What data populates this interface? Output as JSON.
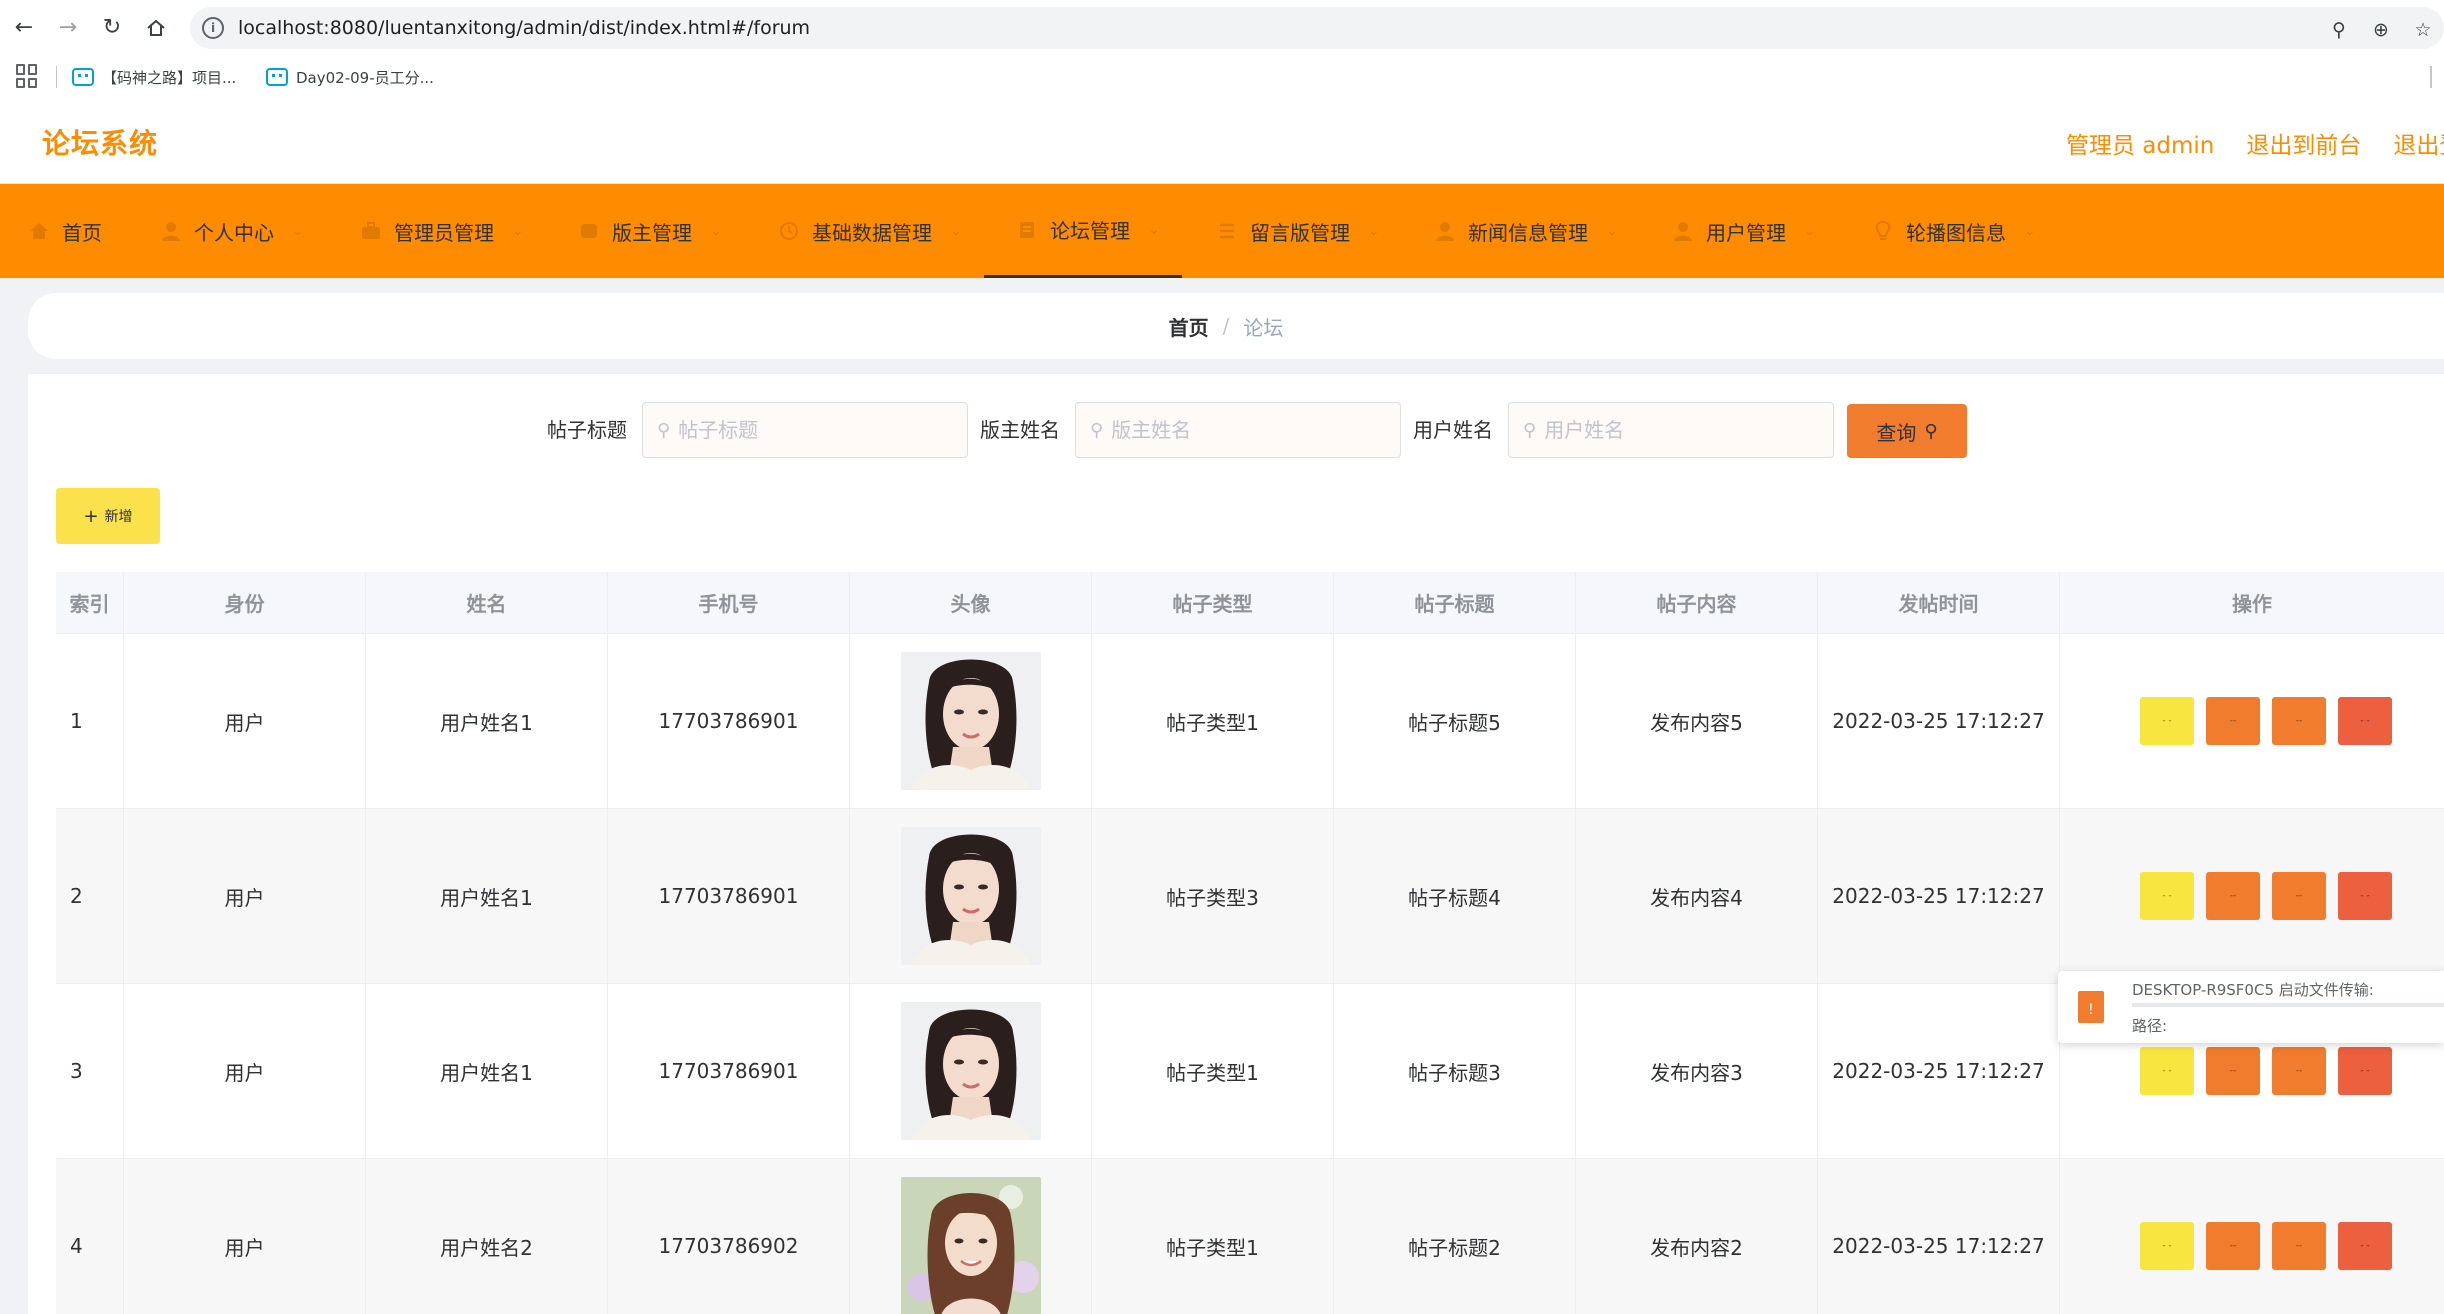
{
  "browser": {
    "url_host": "localhost",
    "url_rest": ":8080/luentanxitong/admin/dist/index.html#/forum",
    "bookmarks": [
      {
        "label": "【码神之路】项目..."
      },
      {
        "label": "Day02-09-员工分..."
      }
    ]
  },
  "header": {
    "title": "论坛系统",
    "admin_label": "管理员 admin",
    "front_label": "退出到前台",
    "logout_label": "退出登"
  },
  "menu": {
    "items": [
      {
        "label": "首页",
        "icon": "home-icon"
      },
      {
        "label": "个人中心",
        "icon": "user-icon"
      },
      {
        "label": "管理员管理",
        "icon": "briefcase-icon"
      },
      {
        "label": "版主管理",
        "icon": "cube-icon"
      },
      {
        "label": "基础数据管理",
        "icon": "clock-icon"
      },
      {
        "label": "论坛管理",
        "icon": "document-icon"
      },
      {
        "label": "留言版管理",
        "icon": "list-icon"
      },
      {
        "label": "新闻信息管理",
        "icon": "user-icon"
      },
      {
        "label": "用户管理",
        "icon": "user-icon"
      },
      {
        "label": "轮播图信息",
        "icon": "bulb-icon"
      }
    ],
    "active": "论坛管理"
  },
  "breadcrumb": {
    "home": "首页",
    "separator": "/",
    "current": "论坛"
  },
  "search": {
    "title_label": "帖子标题",
    "title_placeholder": "帖子标题",
    "moderator_label": "版主姓名",
    "moderator_placeholder": "版主姓名",
    "user_label": "用户姓名",
    "user_placeholder": "用户姓名",
    "query_label": "查询"
  },
  "toolbar": {
    "add_label": "新增"
  },
  "table": {
    "columns": [
      "索引",
      "身份",
      "姓名",
      "手机号",
      "头像",
      "帖子类型",
      "帖子标题",
      "帖子内容",
      "发帖时间",
      "操作"
    ],
    "rows": [
      {
        "index": "1",
        "role": "用户",
        "name": "用户姓名1",
        "phone": "17703786901",
        "type": "帖子类型1",
        "title": "帖子标题5",
        "content": "发布内容5",
        "time": "2022-03-25 17:12:27"
      },
      {
        "index": "2",
        "role": "用户",
        "name": "用户姓名1",
        "phone": "17703786901",
        "type": "帖子类型3",
        "title": "帖子标题4",
        "content": "发布内容4",
        "time": "2022-03-25 17:12:27"
      },
      {
        "index": "3",
        "role": "用户",
        "name": "用户姓名1",
        "phone": "17703786901",
        "type": "帖子类型1",
        "title": "帖子标题3",
        "content": "发布内容3",
        "time": "2022-03-25 17:12:27"
      },
      {
        "index": "4",
        "role": "用户",
        "name": "用户姓名2",
        "phone": "17703786902",
        "type": "帖子类型1",
        "title": "帖子标题2",
        "content": "发布内容2",
        "time": "2022-03-25 17:12:27"
      }
    ]
  },
  "toast": {
    "title": "DESKTOP-R9SF0C5 启动文件传输:",
    "path_label": "路径:"
  },
  "colors": {
    "brand_orange": "#ff8c00",
    "button_yellow": "#f9e53f",
    "button_orange": "#f17c2e",
    "button_red": "#ec5f3f"
  }
}
